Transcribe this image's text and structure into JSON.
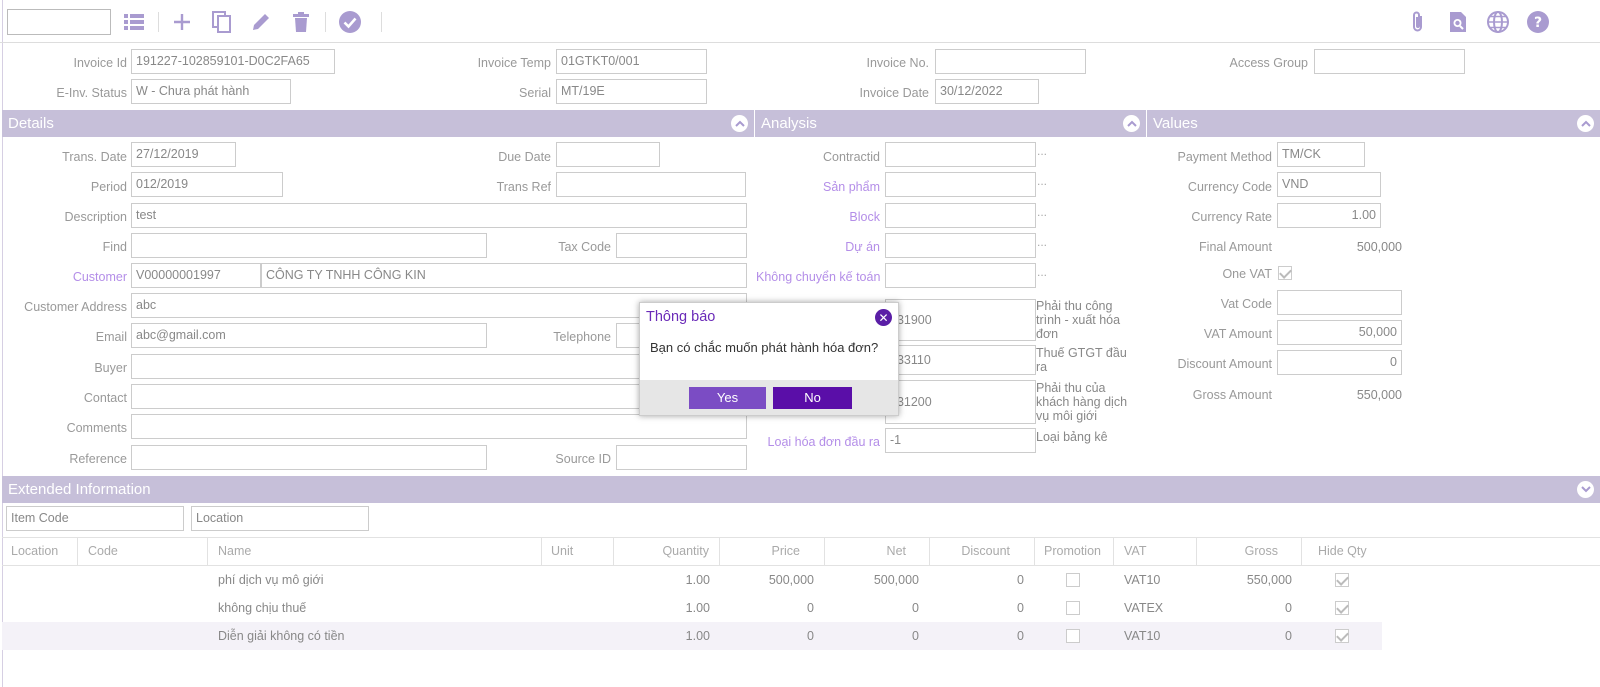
{
  "colors": {
    "accent": "#5a1ea6",
    "section": "#c6bfd9",
    "link": "#b48ee8",
    "icon": "#a99bd0"
  },
  "toolbar": {
    "icons": [
      "list-icon",
      "plus-icon",
      "copy-icon",
      "pencil-icon",
      "trash-icon",
      "check-circle-icon",
      "paperclip-icon",
      "search-doc-icon",
      "globe-icon",
      "help-icon"
    ]
  },
  "header": {
    "invoice_id_label": "Invoice Id",
    "invoice_id": "191227-102859101-D0C2FA65",
    "invoice_temp_label": "Invoice Temp",
    "invoice_temp": "01GTKT0/001",
    "invoice_no_label": "Invoice No.",
    "invoice_no": "",
    "access_group_label": "Access Group",
    "access_group": "",
    "einv_status_label": "E-Inv. Status",
    "einv_status": "W - Chưa phát hành",
    "serial_label": "Serial",
    "serial": "MT/19E",
    "invoice_date_label": "Invoice Date",
    "invoice_date": "30/12/2022"
  },
  "details": {
    "title": "Details",
    "trans_date_label": "Trans. Date",
    "trans_date": "27/12/2019",
    "due_date_label": "Due Date",
    "due_date": "",
    "period_label": "Period",
    "period": "012/2019",
    "trans_ref_label": "Trans Ref",
    "trans_ref": "",
    "description_label": "Description",
    "description": "test",
    "find_label": "Find",
    "find": "",
    "tax_code_label": "Tax Code",
    "tax_code": "",
    "customer_label": "Customer",
    "customer_code": "V00000001997",
    "customer_name": "CÔNG TY TNHH CÔNG KIN",
    "customer_address_label": "Customer Address",
    "customer_address": "abc",
    "email_label": "Email",
    "email": "abc@gmail.com",
    "telephone_label": "Telephone",
    "buyer_label": "Buyer",
    "contact_label": "Contact",
    "comments_label": "Comments",
    "reference_label": "Reference",
    "source_id_label": "Source ID"
  },
  "analysis": {
    "title": "Analysis",
    "contractid_label": "Contractid",
    "san_pham_label": "Sản phẩm",
    "block_label": "Block",
    "du_an_label": "Dự án",
    "khong_chuyen_label": "Không chuyển kế toán",
    "acct1": "131900",
    "acct1_note": "Phải thu công trình - xuất hóa đơn",
    "acct2": "333110",
    "acct2_note": "Thuế GTGT đầu ra",
    "acct3": "131200",
    "acct3_note": "Phải thu của khách hàng dịch vụ môi giới",
    "loai_hd_label": "Loại hóa đơn đầu ra",
    "loai_hd": "-1",
    "loai_hd_note": "Loại bảng kê",
    "dots": "..."
  },
  "values": {
    "title": "Values",
    "payment_method_label": "Payment Method",
    "payment_method": "TM/CK",
    "currency_code_label": "Currency Code",
    "currency_code": "VND",
    "currency_rate_label": "Currency Rate",
    "currency_rate": "1.00",
    "final_amount_label": "Final Amount",
    "final_amount": "500,000",
    "one_vat_label": "One VAT",
    "one_vat_checked": true,
    "vat_code_label": "Vat Code",
    "vat_code": "",
    "vat_amount_label": "VAT Amount",
    "vat_amount": "50,000",
    "discount_amount_label": "Discount Amount",
    "discount_amount": "0",
    "gross_amount_label": "Gross Amount",
    "gross_amount": "550,000"
  },
  "extended": {
    "title": "Extended Information",
    "item_code_placeholder": "Item Code",
    "location_placeholder": "Location",
    "columns": [
      "Location",
      "Code",
      "Name",
      "Unit",
      "Quantity",
      "Price",
      "Net",
      "Discount",
      "Promotion",
      "VAT",
      "Gross",
      "Hide Qty"
    ],
    "rows": [
      {
        "name": "phí dịch vụ mô giới",
        "quantity": "1.00",
        "price": "500,000",
        "net": "500,000",
        "discount": "0",
        "promotion": false,
        "vat": "VAT10",
        "gross": "550,000",
        "hide_qty": true
      },
      {
        "name": "không chịu thuế",
        "quantity": "1.00",
        "price": "0",
        "net": "0",
        "discount": "0",
        "promotion": false,
        "vat": "VATEX",
        "gross": "0",
        "hide_qty": true
      },
      {
        "name": "Diễn giải không có tiền",
        "quantity": "1.00",
        "price": "0",
        "net": "0",
        "discount": "0",
        "promotion": false,
        "vat": "VAT10",
        "gross": "0",
        "hide_qty": true
      }
    ]
  },
  "dialog": {
    "title": "Thông báo",
    "message": "Bạn có chắc muốn phát hành hóa đơn?",
    "yes_label": "Yes",
    "no_label": "No"
  }
}
